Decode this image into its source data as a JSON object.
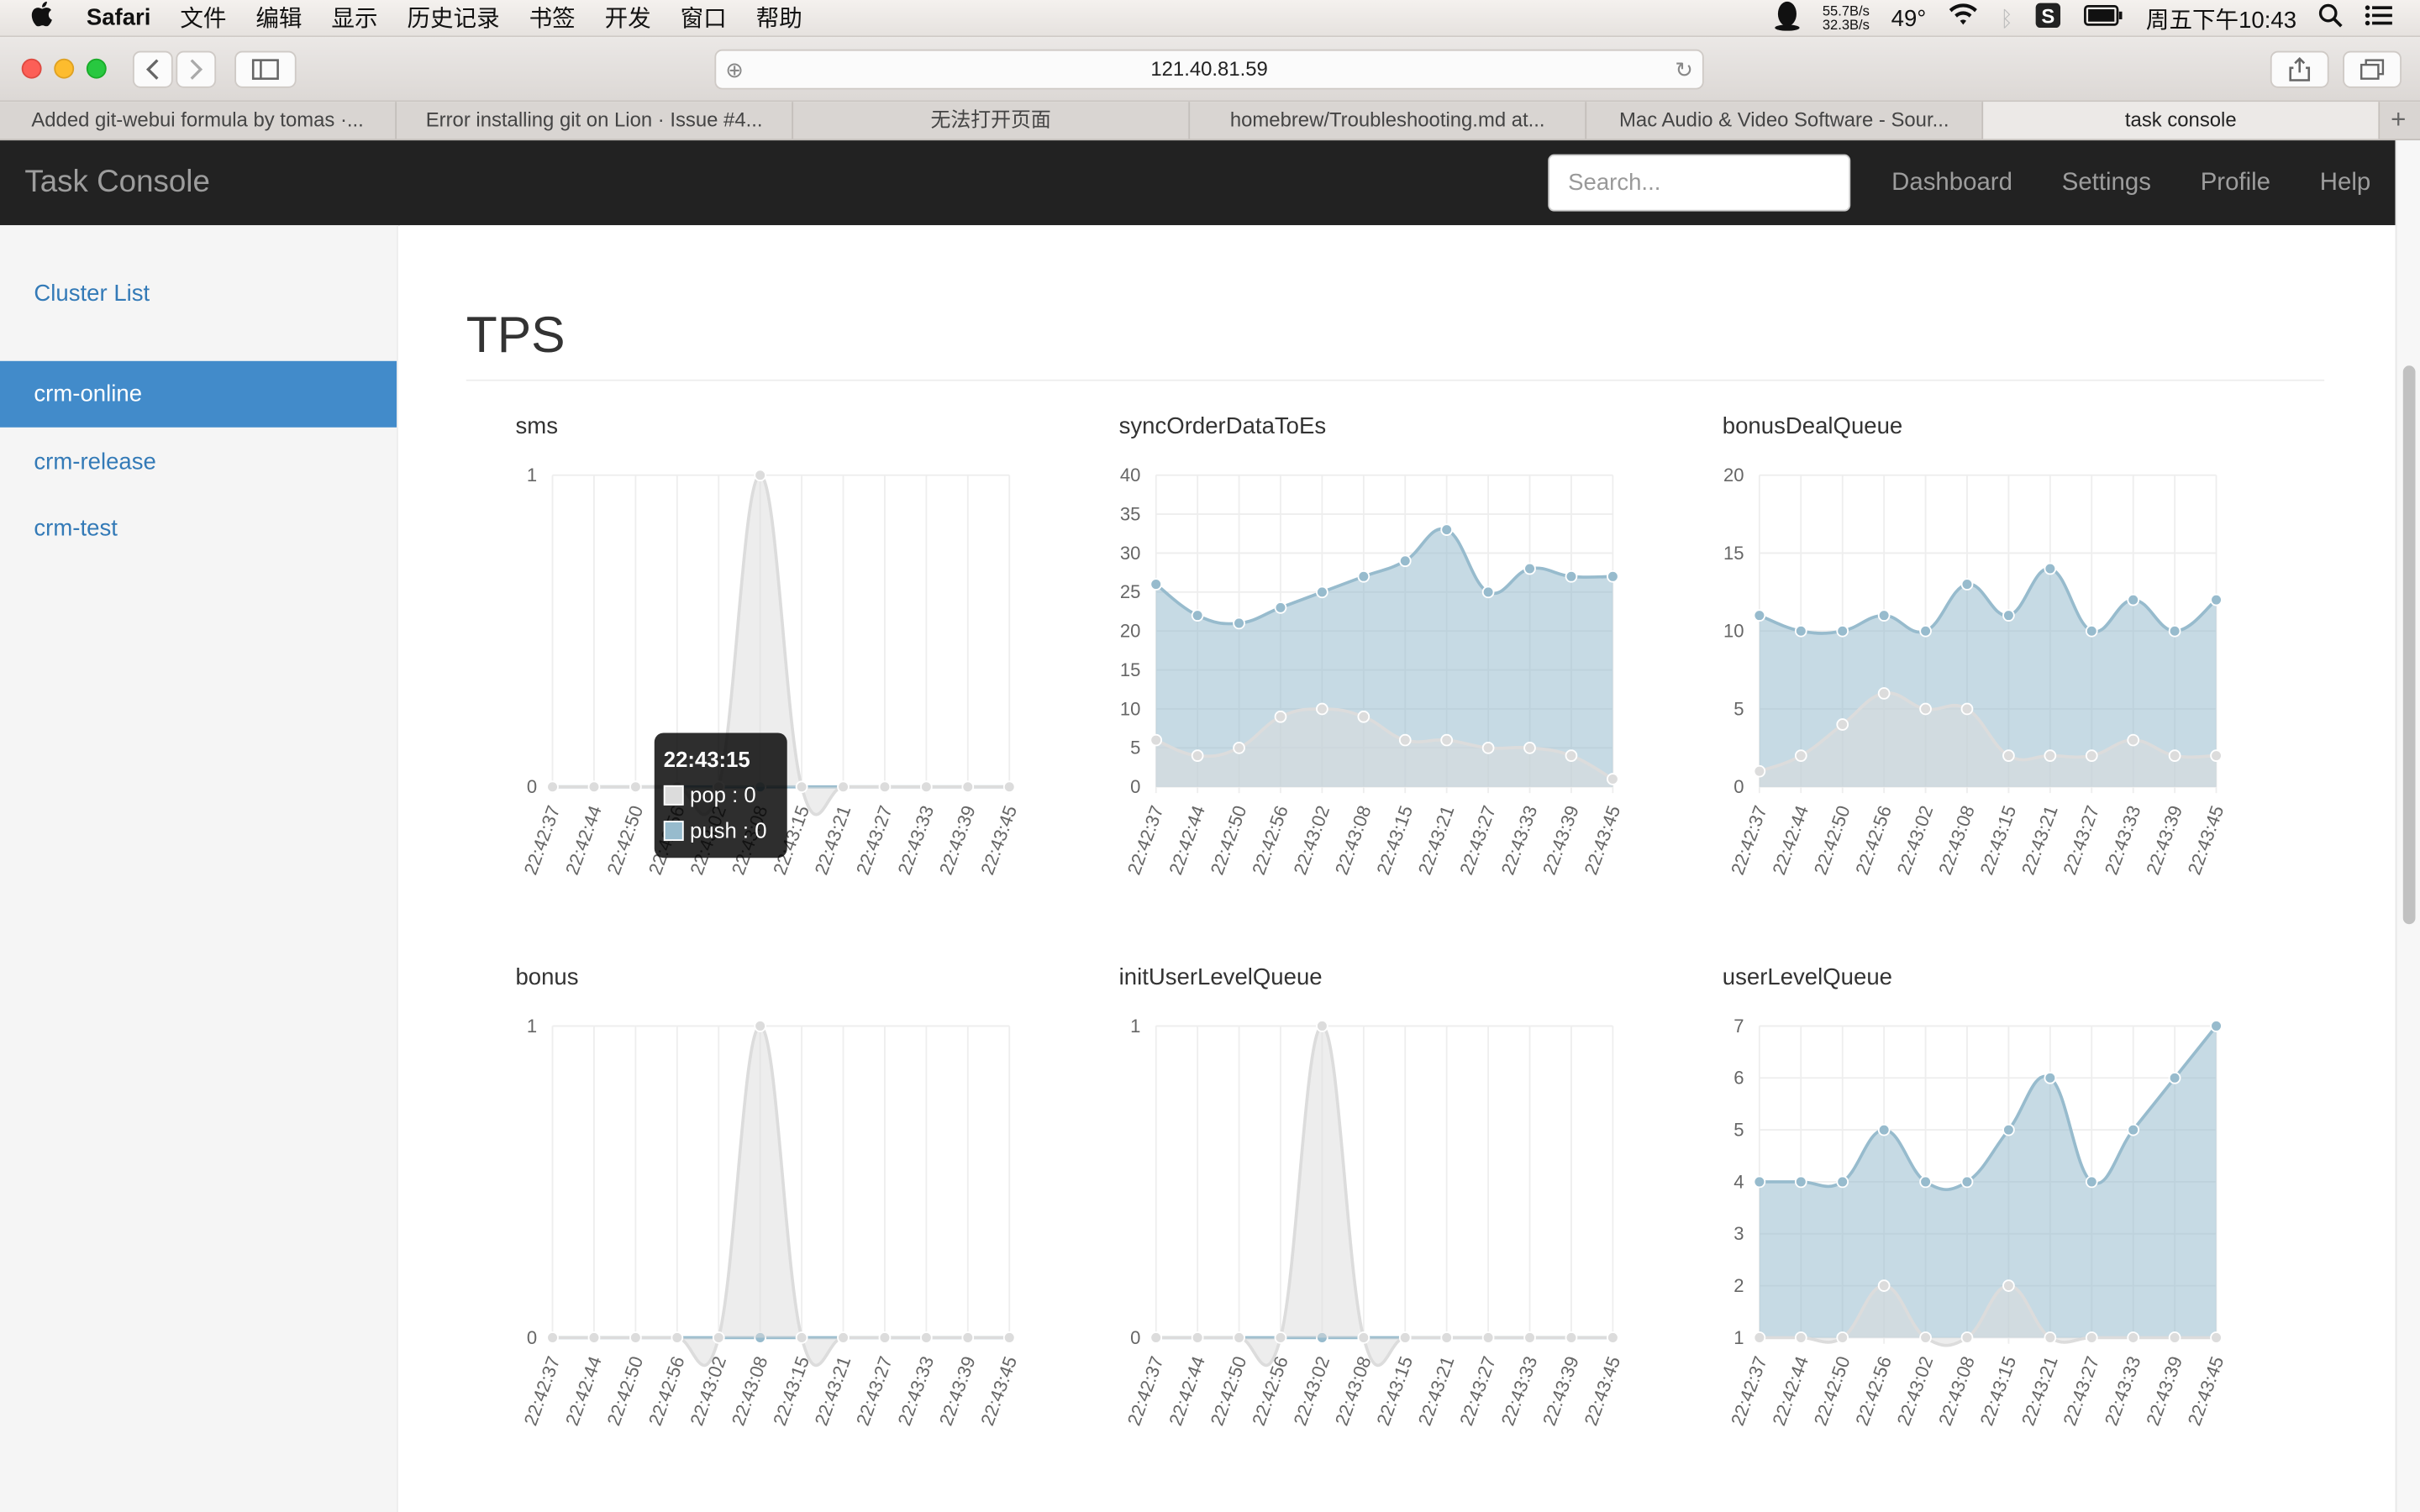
{
  "menubar": {
    "app": "Safari",
    "items": [
      "文件",
      "编辑",
      "显示",
      "历史记录",
      "书签",
      "开发",
      "窗口",
      "帮助"
    ],
    "net_up": "55.7B/s",
    "net_down": "32.3B/s",
    "temp": "49°",
    "clock": "周五下午10:43"
  },
  "browser": {
    "url": "121.40.81.59",
    "tabs": [
      "Added git-webui formula by tomas ·...",
      "Error installing git on Lion · Issue #4...",
      "无法打开页面",
      "homebrew/Troubleshooting.md at...",
      "Mac Audio & Video Software - Sour...",
      "task console"
    ],
    "active_tab": 5
  },
  "navbar": {
    "brand": "Task Console",
    "search_placeholder": "Search...",
    "links": [
      "Dashboard",
      "Settings",
      "Profile",
      "Help"
    ]
  },
  "sidebar": {
    "items": [
      "Cluster List",
      "crm-online",
      "crm-release",
      "crm-test"
    ],
    "active": 1
  },
  "page": {
    "title": "TPS"
  },
  "colors": {
    "pop": "#dcdcdc",
    "push": "#97bbcd"
  },
  "tooltip": {
    "title": "22:43:15",
    "pop": "pop : 0",
    "push": "push : 0"
  },
  "chart_data": [
    {
      "type": "area",
      "title": "sms",
      "x": [
        "22:42:37",
        "22:42:44",
        "22:42:50",
        "22:42:56",
        "22:43:02",
        "22:43:08",
        "22:43:15",
        "22:43:21",
        "22:43:27",
        "22:43:33",
        "22:43:39",
        "22:43:45"
      ],
      "ylim": [
        0,
        1
      ],
      "yticks": [
        0,
        1
      ],
      "series": [
        {
          "name": "pop",
          "values": [
            0,
            0,
            0,
            0,
            0,
            1,
            0,
            0,
            0,
            0,
            0,
            0
          ]
        },
        {
          "name": "push",
          "values": [
            0,
            0,
            0,
            0,
            0,
            0,
            0,
            0,
            0,
            0,
            0,
            0
          ]
        }
      ]
    },
    {
      "type": "area",
      "title": "syncOrderDataToEs",
      "x": [
        "22:42:37",
        "22:42:44",
        "22:42:50",
        "22:42:56",
        "22:43:02",
        "22:43:08",
        "22:43:15",
        "22:43:21",
        "22:43:27",
        "22:43:33",
        "22:43:39",
        "22:43:45"
      ],
      "ylim": [
        0,
        40
      ],
      "yticks": [
        0,
        5,
        10,
        15,
        20,
        25,
        30,
        35,
        40
      ],
      "series": [
        {
          "name": "pop",
          "values": [
            6,
            4,
            5,
            9,
            10,
            9,
            6,
            6,
            5,
            5,
            4,
            1
          ]
        },
        {
          "name": "push",
          "values": [
            26,
            22,
            21,
            23,
            25,
            27,
            29,
            33,
            25,
            28,
            27,
            27
          ]
        }
      ]
    },
    {
      "type": "area",
      "title": "bonusDealQueue",
      "x": [
        "22:42:37",
        "22:42:44",
        "22:42:50",
        "22:42:56",
        "22:43:02",
        "22:43:08",
        "22:43:15",
        "22:43:21",
        "22:43:27",
        "22:43:33",
        "22:43:39",
        "22:43:45"
      ],
      "ylim": [
        0,
        20
      ],
      "yticks": [
        0,
        5,
        10,
        15,
        20
      ],
      "series": [
        {
          "name": "pop",
          "values": [
            1,
            2,
            4,
            6,
            5,
            5,
            2,
            2,
            2,
            3,
            2,
            2
          ]
        },
        {
          "name": "push",
          "values": [
            11,
            10,
            10,
            11,
            10,
            13,
            11,
            14,
            10,
            12,
            10,
            12
          ]
        }
      ]
    },
    {
      "type": "area",
      "title": "bonus",
      "x": [
        "22:42:37",
        "22:42:44",
        "22:42:50",
        "22:42:56",
        "22:43:02",
        "22:43:08",
        "22:43:15",
        "22:43:21",
        "22:43:27",
        "22:43:33",
        "22:43:39",
        "22:43:45"
      ],
      "ylim": [
        0,
        1
      ],
      "yticks": [
        0,
        1
      ],
      "series": [
        {
          "name": "pop",
          "values": [
            0,
            0,
            0,
            0,
            0,
            1,
            0,
            0,
            0,
            0,
            0,
            0
          ]
        },
        {
          "name": "push",
          "values": [
            0,
            0,
            0,
            0,
            0,
            0,
            0,
            0,
            0,
            0,
            0,
            0
          ]
        }
      ]
    },
    {
      "type": "area",
      "title": "initUserLevelQueue",
      "x": [
        "22:42:37",
        "22:42:44",
        "22:42:50",
        "22:42:56",
        "22:43:02",
        "22:43:08",
        "22:43:15",
        "22:43:21",
        "22:43:27",
        "22:43:33",
        "22:43:39",
        "22:43:45"
      ],
      "ylim": [
        0,
        1
      ],
      "yticks": [
        0,
        1
      ],
      "series": [
        {
          "name": "pop",
          "values": [
            0,
            0,
            0,
            0,
            1,
            0,
            0,
            0,
            0,
            0,
            0,
            0
          ]
        },
        {
          "name": "push",
          "values": [
            0,
            0,
            0,
            0,
            0,
            0,
            0,
            0,
            0,
            0,
            0,
            0
          ]
        }
      ]
    },
    {
      "type": "area",
      "title": "userLevelQueue",
      "x": [
        "22:42:37",
        "22:42:44",
        "22:42:50",
        "22:42:56",
        "22:43:02",
        "22:43:08",
        "22:43:15",
        "22:43:21",
        "22:43:27",
        "22:43:33",
        "22:43:39",
        "22:43:45"
      ],
      "ylim": [
        1,
        7
      ],
      "yticks": [
        1,
        2,
        3,
        4,
        5,
        6,
        7
      ],
      "series": [
        {
          "name": "pop",
          "values": [
            1,
            1,
            1,
            2,
            1,
            1,
            2,
            1,
            1,
            1,
            1,
            1
          ]
        },
        {
          "name": "push",
          "values": [
            4,
            4,
            4,
            5,
            4,
            4,
            5,
            6,
            4,
            5,
            6,
            7
          ]
        }
      ]
    }
  ]
}
